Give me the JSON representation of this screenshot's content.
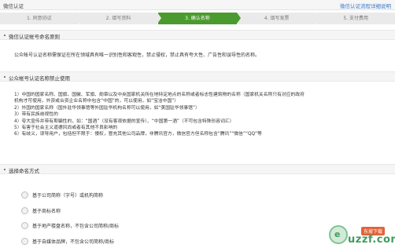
{
  "header": {
    "title": "微信认证",
    "help_link": "微信认证流程详细说明"
  },
  "steps": [
    {
      "label": "1. 同意协议",
      "active": false
    },
    {
      "label": "2. 填写资料",
      "active": false
    },
    {
      "label": "3. 确认名称",
      "active": true
    },
    {
      "label": "4. 填写发票",
      "active": false
    },
    {
      "label": "5. 支付费用",
      "active": false
    }
  ],
  "sections": {
    "principle": {
      "title": "微信认证帐号命名原则",
      "text": "公众帐号认证名称需保证在所在领域具有唯一识别性和客观性，禁止侵权，禁止具有夸大性、广告性和误导性的名称。"
    },
    "prohibited": {
      "title": "公众帐号认证名称禁止使用",
      "rules": [
        "1）中国的国家名称、国旗、国徽、军旗、勋章以及中央国家机关所在地特定地点的名称或者标志性建筑物的名称（国家机关名称只有对应的政府",
        "机构才可使用，外资或合资企业名称中包含“中国”的，可以使用，如“宝洁中国”）",
        "2）外国的国家名称（国外驻华领事馆等外国驻华机构名称可以使用，如“美国驻华领事馆”）",
        "3）带有民族歧视性的",
        "4）夸大宣传并带有欺骗性的，如：“国酒”（没有客观依据的宣传）、“中国第一酒”（不可包含特殊形容词汇）",
        "5）有害于社会主义道德风尚或者有其他不良影响的",
        "6）有歧义，误导用户，包括但不限于：侵权，冒充其他公司品牌，非腾讯官方，微信官方但名称包含“腾讯”“微信”“QQ”等"
      ]
    },
    "naming": {
      "title": "选择命名方式",
      "options": [
        "基于公司简称（字号）或机构简称",
        "基于商标名称",
        "基于地产楼盘名称，不包含公司简称/商标",
        "基于自媒体品牌，不包含公司简称/商标"
      ]
    }
  },
  "watermark": {
    "brand": "uzzf.com",
    "badge": "东坡下载"
  }
}
